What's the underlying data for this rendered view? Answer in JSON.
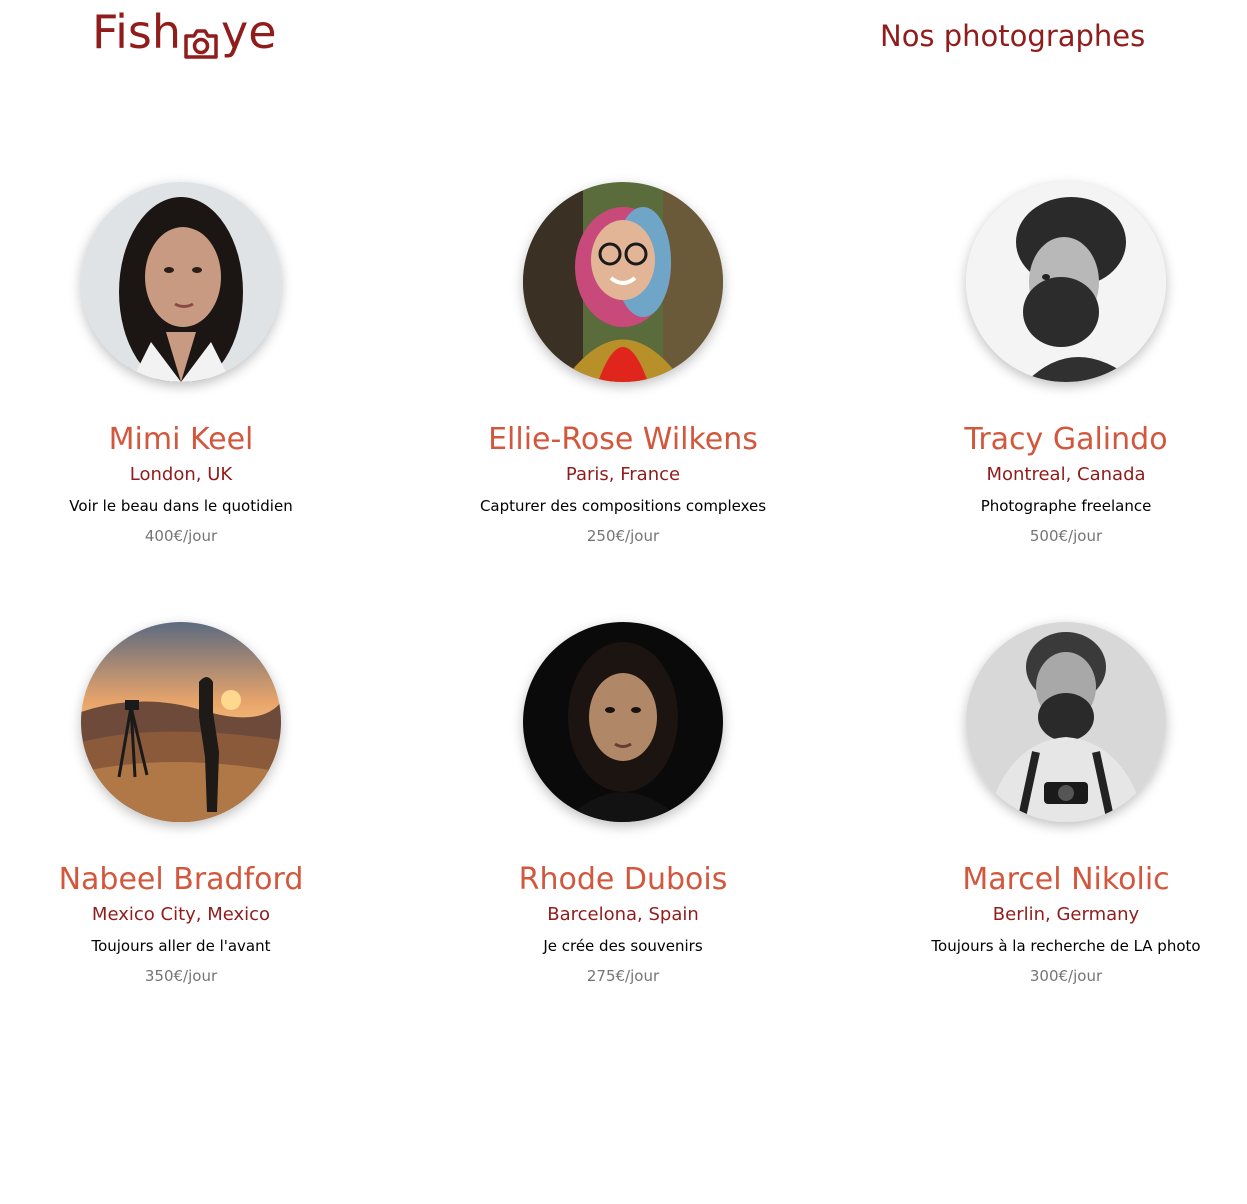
{
  "header": {
    "logo_alt": "FishEye",
    "logo_left": "Fish",
    "logo_right": "ye",
    "title": "Nos photographes"
  },
  "colors": {
    "brand": "#901C1C",
    "name": "#D3573C",
    "price": "#757575"
  },
  "photographers": [
    {
      "name": "Mimi Keel",
      "location": "London, UK",
      "tagline": "Voir le beau dans le quotidien",
      "price": "400€/jour",
      "portrait_icon": "portrait-woman-long-dark-hair"
    },
    {
      "name": "Ellie-Rose Wilkens",
      "location": "Paris, France",
      "tagline": "Capturer des compositions complexes",
      "price": "250€/jour",
      "portrait_icon": "portrait-woman-glasses-colorful-hair"
    },
    {
      "name": "Tracy Galindo",
      "location": "Montreal, Canada",
      "tagline": "Photographe freelance",
      "price": "500€/jour",
      "portrait_icon": "portrait-man-curly-hair-bw"
    },
    {
      "name": "Nabeel Bradford",
      "location": "Mexico City, Mexico",
      "tagline": "Toujours aller de l'avant",
      "price": "350€/jour",
      "portrait_icon": "landscape-sunset-silhouette-tripod"
    },
    {
      "name": "Rhode Dubois",
      "location": "Barcelona, Spain",
      "tagline": "Je crée des souvenirs",
      "price": "275€/jour",
      "portrait_icon": "portrait-woman-dark-background"
    },
    {
      "name": "Marcel Nikolic",
      "location": "Berlin, Germany",
      "tagline": "Toujours à la recherche de LA photo",
      "price": "300€/jour",
      "portrait_icon": "portrait-man-beard-camera-bw"
    }
  ]
}
